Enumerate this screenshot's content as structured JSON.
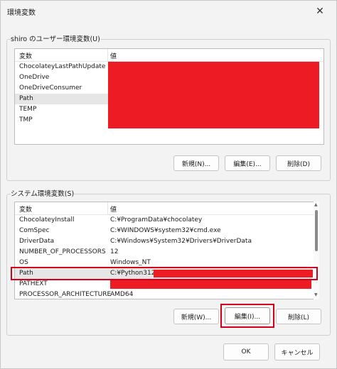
{
  "window": {
    "title": "環境変数",
    "close_glyph": "✕"
  },
  "user_section": {
    "label": "shiro のユーザー環境変数(U)",
    "columns": [
      "変数",
      "値"
    ],
    "rows": [
      {
        "name": "ChocolateyLastPathUpdate"
      },
      {
        "name": "OneDrive"
      },
      {
        "name": "OneDriveConsumer"
      },
      {
        "name": "Path"
      },
      {
        "name": "TEMP"
      },
      {
        "name": "TMP"
      }
    ],
    "buttons": {
      "new": "新規(N)...",
      "edit": "編集(E)...",
      "delete": "削除(D)"
    }
  },
  "system_section": {
    "label": "システム環境変数(S)",
    "columns": [
      "変数",
      "値"
    ],
    "rows": [
      {
        "name": "ChocolateyInstall",
        "value": "C:¥ProgramData¥chocolatey"
      },
      {
        "name": "ComSpec",
        "value": "C:¥WINDOWS¥system32¥cmd.exe"
      },
      {
        "name": "DriverData",
        "value": "C:¥Windows¥System32¥Drivers¥DriverData"
      },
      {
        "name": "NUMBER_OF_PROCESSORS",
        "value": "12"
      },
      {
        "name": "OS",
        "value": "Windows_NT"
      },
      {
        "name": "Path",
        "value": "C:¥Python312"
      },
      {
        "name": "PATHEXT",
        "value": ""
      },
      {
        "name": "PROCESSOR_ARCHITECTURE",
        "value": "AMD64"
      }
    ],
    "buttons": {
      "new": "新規(W)...",
      "edit": "編集(I)...",
      "delete": "削除(L)"
    }
  },
  "footer": {
    "ok": "OK",
    "cancel": "キャンセル"
  },
  "colors": {
    "redaction": "#ed1c24",
    "highlight": "#d4001b"
  }
}
